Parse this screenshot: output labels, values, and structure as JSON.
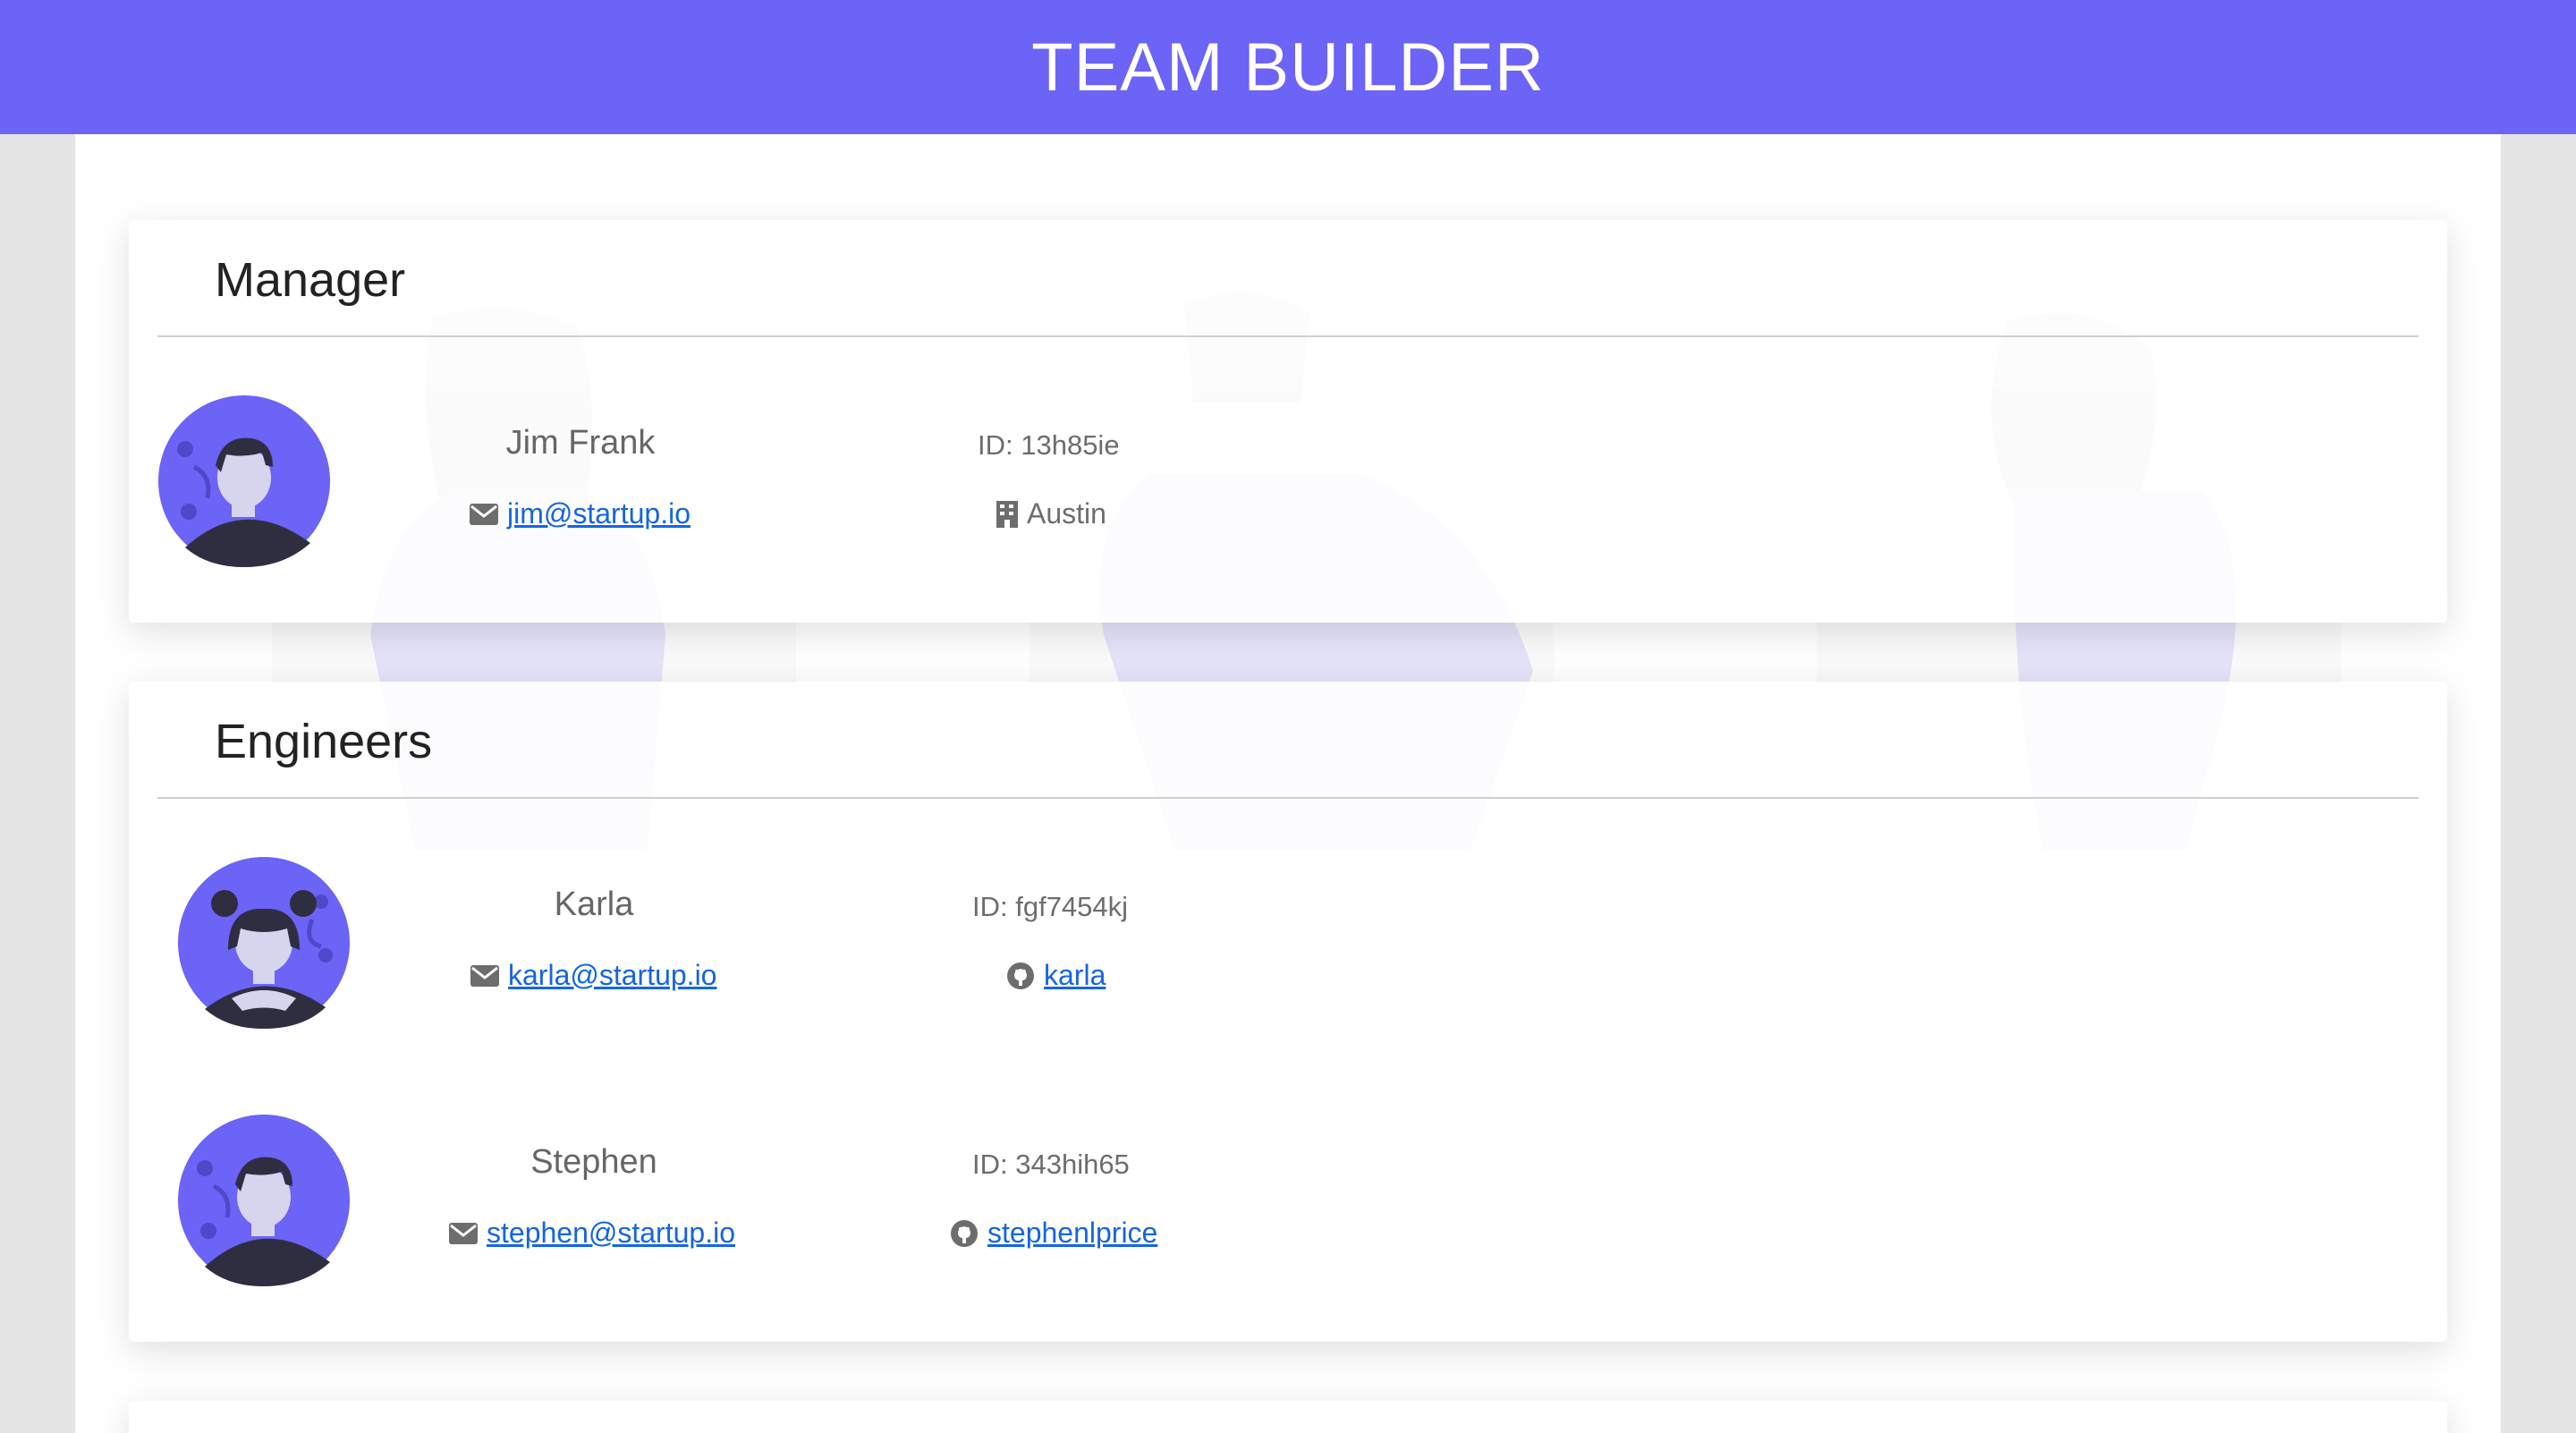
{
  "header": {
    "title": "TEAM BUILDER"
  },
  "colors": {
    "accent": "#6c63f7",
    "link": "#1565e0"
  },
  "manager_section": {
    "title": "Manager",
    "members": [
      {
        "name": "Jim Frank",
        "id": "ID: 13h85ie",
        "email": "jim@startup.io",
        "email_icon": "envelope-icon",
        "detail": "Austin",
        "detail_icon": "building-icon"
      }
    ]
  },
  "engineers_section": {
    "title": "Engineers",
    "members": [
      {
        "name": "Karla",
        "id": "ID: fgf7454kj",
        "email": "karla@startup.io",
        "email_icon": "envelope-icon",
        "detail": "karla",
        "detail_icon": "github-icon"
      },
      {
        "name": "Stephen",
        "id": "ID: 343hih65",
        "email": "stephen@startup.io",
        "email_icon": "envelope-icon",
        "detail": "stephenlprice",
        "detail_icon": "github-icon"
      }
    ]
  }
}
